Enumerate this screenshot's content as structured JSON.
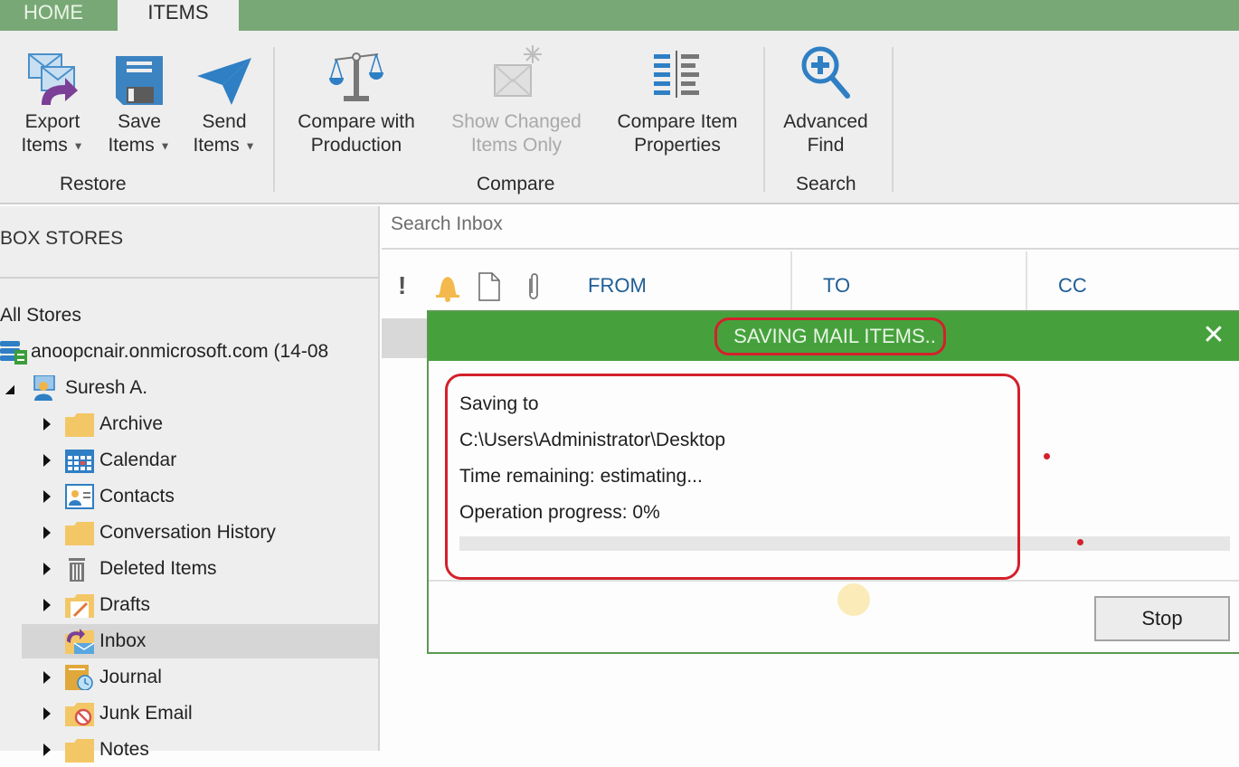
{
  "tabs": [
    {
      "label": "HOME",
      "active": false
    },
    {
      "label": "ITEMS",
      "active": true
    }
  ],
  "ribbon": {
    "restore": {
      "group_label": "Restore",
      "buttons": [
        {
          "line1": "Export",
          "line2": "Items",
          "icon": "export-items-icon",
          "dropdown": true
        },
        {
          "line1": "Save",
          "line2": "Items",
          "icon": "save-items-icon",
          "dropdown": true
        },
        {
          "line1": "Send",
          "line2": "Items",
          "icon": "send-items-icon",
          "dropdown": true
        }
      ]
    },
    "compare": {
      "group_label": "Compare",
      "buttons": [
        {
          "line1": "Compare with",
          "line2": "Production",
          "icon": "scales-icon",
          "disabled": false
        },
        {
          "line1": "Show Changed",
          "line2": "Items Only",
          "icon": "changed-mail-icon",
          "disabled": true
        },
        {
          "line1": "Compare Item",
          "line2": "Properties",
          "icon": "compare-properties-icon",
          "disabled": false
        }
      ]
    },
    "search": {
      "group_label": "Search",
      "buttons": [
        {
          "line1": "Advanced",
          "line2": "Find",
          "icon": "zoom-plus-icon"
        }
      ]
    },
    "dropdown_glyph": "▼"
  },
  "sidebar": {
    "title": "BOX STORES",
    "all_stores": "All Stores",
    "store": "anoopcnair.onmicrosoft.com (14-08",
    "user": "Suresh A.",
    "folders": [
      {
        "label": "Archive",
        "icon": "folder-icon",
        "expandable": true,
        "selected": false
      },
      {
        "label": "Calendar",
        "icon": "calendar-icon",
        "expandable": true,
        "selected": false
      },
      {
        "label": "Contacts",
        "icon": "contacts-icon",
        "expandable": true,
        "selected": false
      },
      {
        "label": "Conversation History",
        "icon": "folder-icon",
        "expandable": true,
        "selected": false
      },
      {
        "label": "Deleted Items",
        "icon": "trash-icon",
        "expandable": true,
        "selected": false
      },
      {
        "label": "Drafts",
        "icon": "drafts-icon",
        "expandable": true,
        "selected": false
      },
      {
        "label": "Inbox",
        "icon": "inbox-icon",
        "expandable": false,
        "selected": true
      },
      {
        "label": "Journal",
        "icon": "journal-icon",
        "expandable": true,
        "selected": false
      },
      {
        "label": "Junk Email",
        "icon": "junk-icon",
        "expandable": true,
        "selected": false
      },
      {
        "label": "Notes",
        "icon": "folder-icon",
        "expandable": true,
        "selected": false
      }
    ]
  },
  "main": {
    "search_placeholder": "Search Inbox",
    "columns": {
      "importance": "!",
      "from": "FROM",
      "to": "TO",
      "cc": "CC"
    }
  },
  "dialog": {
    "title": "SAVING MAIL ITEMS..",
    "close_glyph": "✕",
    "saving_to_label": "Saving to",
    "path": "C:\\Users\\Administrator\\Desktop",
    "time_remaining": "Time remaining:  estimating...",
    "operation_progress": "Operation progress:  0%",
    "progress_fraction": 0,
    "stop_label": "Stop"
  },
  "colors": {
    "tabbar": "#79a877",
    "dialog_header": "#46a13d",
    "annotation": "#d3212b",
    "column_header": "#1f5d96"
  }
}
